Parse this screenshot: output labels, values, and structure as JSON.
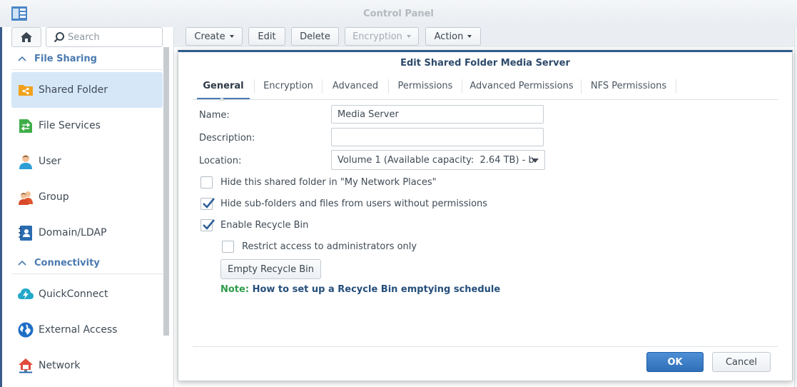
{
  "window": {
    "title": "Control Panel"
  },
  "colors": {
    "accent": "#2f6fb8",
    "section": "#4a7ab0",
    "active_bg": "#d6e7f8",
    "note_green": "#2e9c4a"
  },
  "sidebar": {
    "search_placeholder": "Search",
    "sections": [
      {
        "label": "File Sharing"
      },
      {
        "label": "Connectivity"
      }
    ],
    "items": [
      {
        "label": "Shared Folder",
        "icon": "shared-folder-icon",
        "active": true
      },
      {
        "label": "File Services",
        "icon": "file-services-icon"
      },
      {
        "label": "User",
        "icon": "user-icon"
      },
      {
        "label": "Group",
        "icon": "group-icon"
      },
      {
        "label": "Domain/LDAP",
        "icon": "domain-ldap-icon"
      },
      {
        "label": "QuickConnect",
        "icon": "quickconnect-icon"
      },
      {
        "label": "External Access",
        "icon": "external-access-icon"
      },
      {
        "label": "Network",
        "icon": "network-icon"
      }
    ]
  },
  "toolbar": {
    "create": "Create",
    "edit": "Edit",
    "delete": "Delete",
    "encryption": "Encryption",
    "action": "Action"
  },
  "dialog": {
    "title": "Edit Shared Folder Media Server",
    "tabs": [
      "General",
      "Encryption",
      "Advanced",
      "Permissions",
      "Advanced Permissions",
      "NFS Permissions"
    ],
    "active_tab": "General",
    "fields": {
      "name_label": "Name:",
      "name_value": "Media Server",
      "description_label": "Description:",
      "description_value": "",
      "location_label": "Location:",
      "location_value": "Volume 1 (Available capacity:  2.64 TB) - b"
    },
    "options": [
      {
        "label": "Hide this shared folder in \"My Network Places\"",
        "checked": false
      },
      {
        "label": "Hide sub-folders and files from users without permissions",
        "checked": true
      },
      {
        "label": "Enable Recycle Bin",
        "checked": true
      },
      {
        "label": "Restrict access to administrators only",
        "checked": false
      }
    ],
    "empty_recycle_label": "Empty Recycle Bin",
    "note_prefix": "Note:",
    "note_link": "How to set up a Recycle Bin emptying schedule",
    "ok_label": "OK",
    "cancel_label": "Cancel"
  }
}
